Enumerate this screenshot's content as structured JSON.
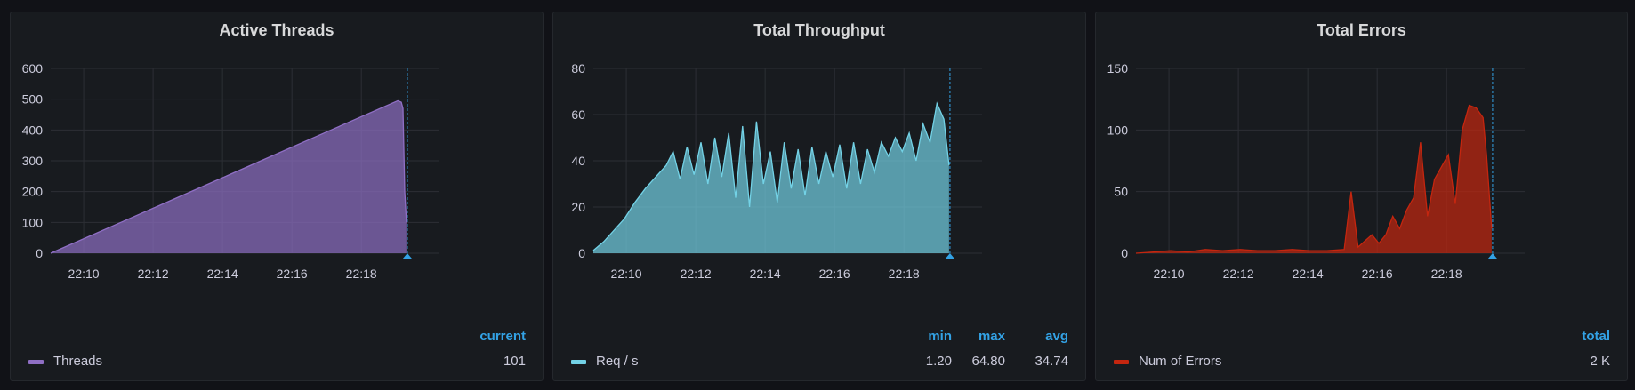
{
  "panels": [
    {
      "title": "Active Threads",
      "legend": {
        "columns": [
          "current"
        ],
        "series_label": "Threads",
        "values": [
          "101"
        ]
      }
    },
    {
      "title": "Total Throughput",
      "legend": {
        "columns": [
          "min",
          "max",
          "avg"
        ],
        "series_label": "Req / s",
        "values": [
          "1.20",
          "64.80",
          "34.74"
        ]
      }
    },
    {
      "title": "Total Errors",
      "legend": {
        "columns": [
          "total"
        ],
        "series_label": "Num of Errors",
        "values": [
          "2 K"
        ]
      }
    }
  ],
  "chart_data": [
    {
      "type": "area",
      "title": "Active Threads",
      "x_ticks": [
        "22:10",
        "22:12",
        "22:14",
        "22:16",
        "22:18"
      ],
      "y_ticks": [
        0,
        100,
        200,
        300,
        400,
        500,
        600
      ],
      "ylim": [
        0,
        600
      ],
      "color": "#8f6fc4",
      "series": [
        {
          "name": "Threads",
          "x_minutes": [
            0,
            2,
            4,
            6,
            8,
            10,
            10.1,
            10.15,
            10.2,
            10.25
          ],
          "values": [
            0,
            99,
            198,
            297,
            396,
            495,
            490,
            470,
            200,
            100
          ]
        }
      ]
    },
    {
      "type": "area",
      "title": "Total Throughput",
      "x_ticks": [
        "22:10",
        "22:12",
        "22:14",
        "22:16",
        "22:18"
      ],
      "y_ticks": [
        0,
        20,
        40,
        60,
        80
      ],
      "ylim": [
        0,
        80
      ],
      "color": "#73d2e6",
      "series": [
        {
          "name": "Req / s",
          "x_minutes": [
            0,
            0.3,
            0.6,
            0.9,
            1.2,
            1.5,
            1.8,
            2.1,
            2.3,
            2.5,
            2.7,
            2.9,
            3.1,
            3.3,
            3.5,
            3.7,
            3.9,
            4.1,
            4.3,
            4.5,
            4.7,
            4.9,
            5.1,
            5.3,
            5.5,
            5.7,
            5.9,
            6.1,
            6.3,
            6.5,
            6.7,
            6.9,
            7.1,
            7.3,
            7.5,
            7.7,
            7.9,
            8.1,
            8.3,
            8.5,
            8.7,
            8.9,
            9.1,
            9.3,
            9.5,
            9.7,
            9.9,
            10.1,
            10.25
          ],
          "values": [
            1.2,
            5,
            10,
            15,
            22,
            28,
            33,
            38,
            44,
            32,
            46,
            34,
            48,
            30,
            50,
            33,
            52,
            24,
            55,
            20,
            57,
            30,
            44,
            22,
            48,
            28,
            45,
            25,
            46,
            30,
            44,
            33,
            47,
            28,
            48,
            30,
            45,
            35,
            48,
            42,
            50,
            44,
            52,
            40,
            56,
            48,
            64.8,
            58,
            38
          ]
        }
      ]
    },
    {
      "type": "area",
      "title": "Total Errors",
      "x_ticks": [
        "22:10",
        "22:12",
        "22:14",
        "22:16",
        "22:18"
      ],
      "y_ticks": [
        0,
        50,
        100,
        150
      ],
      "ylim": [
        0,
        150
      ],
      "color": "#c4260f",
      "series": [
        {
          "name": "Num of Errors",
          "x_minutes": [
            0,
            0.5,
            1,
            1.5,
            2,
            2.5,
            3,
            3.5,
            4,
            4.5,
            5,
            5.5,
            6,
            6.2,
            6.4,
            6.6,
            6.8,
            7,
            7.2,
            7.4,
            7.6,
            7.8,
            8,
            8.2,
            8.4,
            8.6,
            8.8,
            9,
            9.2,
            9.4,
            9.6,
            9.8,
            10,
            10.1,
            10.25
          ],
          "values": [
            0,
            1,
            2,
            1,
            3,
            2,
            3,
            2,
            2,
            3,
            2,
            2,
            3,
            50,
            5,
            10,
            15,
            8,
            15,
            30,
            20,
            35,
            45,
            90,
            30,
            60,
            70,
            80,
            40,
            100,
            120,
            118,
            110,
            80,
            20
          ]
        }
      ]
    }
  ]
}
